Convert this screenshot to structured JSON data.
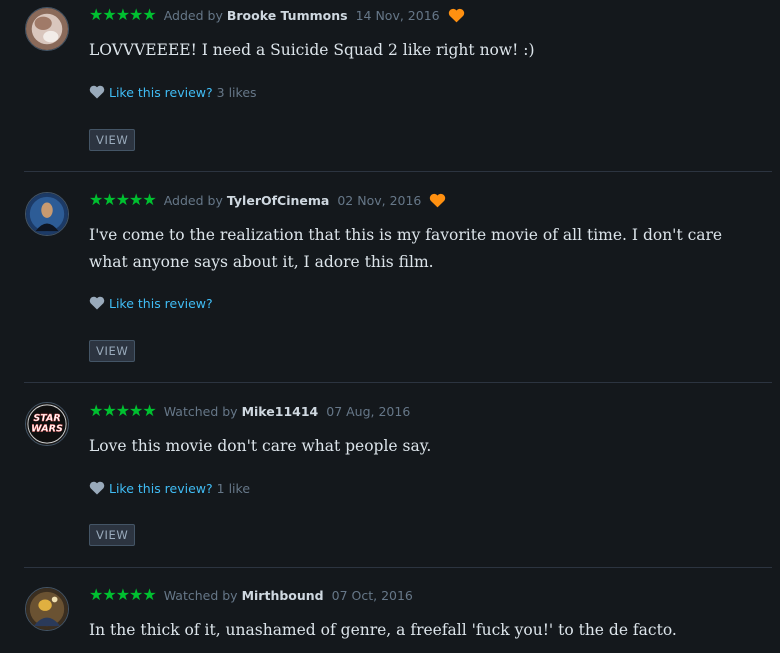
{
  "colors": {
    "background": "#14181c",
    "star_green": "#00c030",
    "heart_orange": "#ff9010",
    "link_blue": "#40bcf4",
    "muted_text": "#667788"
  },
  "reviews": [
    {
      "rating": "★★★★★",
      "verb": "Added by",
      "author": "Brooke Tummons",
      "date": "14 Nov, 2016",
      "liked": true,
      "text": "LOVVVEEEE! I need a Suicide Squad 2 like right now! :)",
      "like_label": "Like this review?",
      "like_count": "3 likes",
      "view_label": "VIEW",
      "avatar_icon": "user-avatar-icon"
    },
    {
      "rating": "★★★★★",
      "verb": "Added by",
      "author": "TylerOfCinema",
      "date": "02 Nov, 2016",
      "liked": true,
      "text": "I've come to the realization that this is my favorite movie of all time. I don't care what anyone says about it, I adore this film.",
      "like_label": "Like this review?",
      "like_count": "",
      "view_label": "VIEW",
      "avatar_icon": "user-avatar-icon"
    },
    {
      "rating": "★★★★★",
      "verb": "Watched by",
      "author": "Mike11414",
      "date": "07 Aug, 2016",
      "liked": false,
      "text": "Love this movie don't care what people say.",
      "like_label": "Like this review?",
      "like_count": "1 like",
      "view_label": "VIEW",
      "avatar_icon": "star-wars-logo-icon",
      "avatar_logo_text": "STAR WARS"
    },
    {
      "rating": "★★★★★",
      "verb": "Watched by",
      "author": "Mirthbound",
      "date": "07 Oct, 2016",
      "liked": false,
      "text": "In the thick of it, unashamed of genre, a freefall 'fuck you!' to the de facto.",
      "avatar_icon": "user-avatar-icon"
    }
  ]
}
